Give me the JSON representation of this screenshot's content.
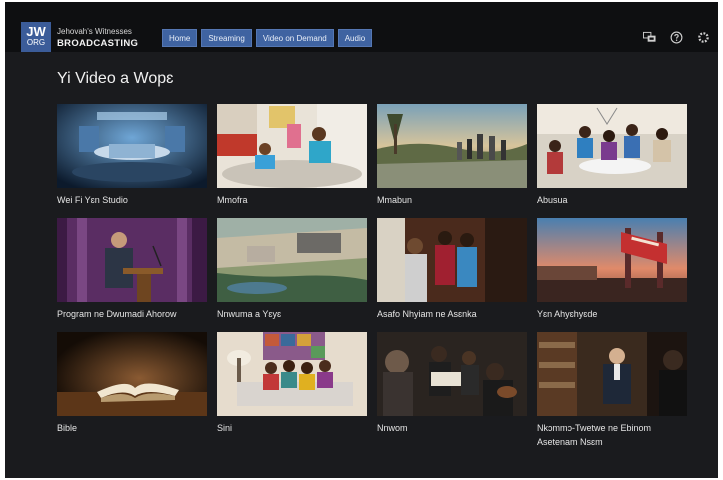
{
  "header": {
    "logo_top": "JW",
    "logo_bottom": "ORG",
    "brand_top": "Jehovah's Witnesses",
    "brand_bottom": "BROADCASTING",
    "nav": [
      "Home",
      "Streaming",
      "Video on Demand",
      "Audio"
    ],
    "icons": [
      "language-icon",
      "help-icon",
      "settings-icon"
    ]
  },
  "page": {
    "title": "Yi Video a Wopɛ"
  },
  "categories": [
    {
      "label": "Wei Fi Yɛn Studio"
    },
    {
      "label": "Mmofra"
    },
    {
      "label": "Mmabun"
    },
    {
      "label": "Abusua"
    },
    {
      "label": "Program ne Dwumadi Ahorow"
    },
    {
      "label": "Nnwuma a Yɛyɛ"
    },
    {
      "label": "Asafo Nhyiam ne Asɛnka"
    },
    {
      "label": "Yɛn Ahyɛhyɛde"
    },
    {
      "label": "Bible"
    },
    {
      "label": "Sini"
    },
    {
      "label": "Nnwom"
    },
    {
      "label": "Nkɔmmɔ-Twetwe ne Ebinom Asetenam Nsɛm"
    }
  ],
  "colors": {
    "background": "#1a1b1e",
    "topbar": "#0e0f11",
    "nav_button": "#3f63a1",
    "logo": "#3b5c99"
  }
}
